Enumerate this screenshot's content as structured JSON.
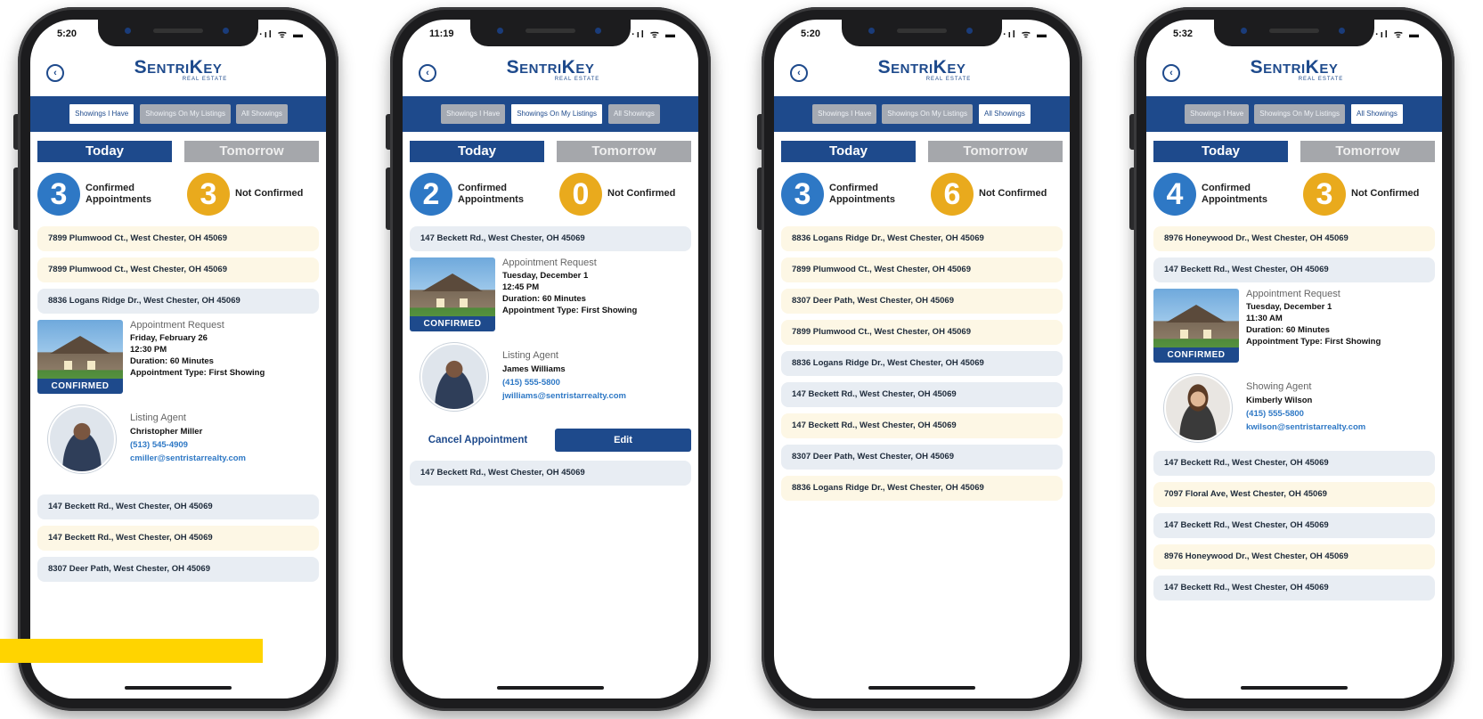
{
  "app": {
    "brand": "SentriKey",
    "sub": "REAL ESTATE"
  },
  "tabs": [
    "Showings I Have",
    "Showings On My Listings",
    "All Showings"
  ],
  "day_today": "Today",
  "day_tomorrow": "Tomorrow",
  "confirmed_label": "Confirmed Appointments",
  "not_confirmed_label": "Not Confirmed",
  "confirmed_badge": "CONFIRMED",
  "appt_heading": "Appointment Request",
  "colors": {
    "accent": "#1e4a8c",
    "count_blue": "#2e78c5",
    "count_gold": "#e9aa1d",
    "highlight": "#ffd400"
  },
  "phones": [
    {
      "time": "5:20",
      "status_icons": "·ıl ᯤ ▬",
      "confirmed": "3",
      "not_confirmed": "3",
      "pre_addresses": [
        "7899 Plumwood Ct., West Chester, OH 45069",
        "7899 Plumwood Ct., West Chester, OH 45069",
        "8836 Logans Ridge Dr., West Chester, OH 45069"
      ],
      "appointment": {
        "date": "Friday, February 26",
        "time": "12:30 PM",
        "duration": "Duration: 60 Minutes",
        "type": "Appointment Type: First Showing"
      },
      "agent": {
        "role": "Listing Agent",
        "name": "Christopher Miller",
        "phone": "(513) 545-4909",
        "email": "cmiller@sentristarrealty.com"
      },
      "post_addresses": [
        "147 Beckett Rd., West Chester, OH 45069",
        "147 Beckett Rd., West Chester, OH 45069",
        "8307 Deer Path, West Chester, OH 45069"
      ]
    },
    {
      "time": "11:19",
      "status_icons": "·ıl ᯤ ▬",
      "confirmed": "2",
      "not_confirmed": "0",
      "pre_addresses": [
        "147 Beckett Rd., West Chester, OH 45069"
      ],
      "appointment": {
        "date": "Tuesday, December 1",
        "time": "12:45 PM",
        "duration": "Duration: 60 Minutes",
        "type": "Appointment Type: First Showing"
      },
      "agent": {
        "role": "Listing Agent",
        "name": "James Williams",
        "phone": "(415) 555-5800",
        "email": "jwilliams@sentristarrealty.com"
      },
      "cancel_label": "Cancel Appointment",
      "edit_label": "Edit",
      "post_addresses": [
        "147 Beckett Rd., West Chester, OH 45069"
      ]
    },
    {
      "time": "5:20",
      "status_icons": "·ıl ᯤ ▬",
      "confirmed": "3",
      "not_confirmed": "6",
      "addresses": [
        "8836 Logans Ridge Dr., West Chester, OH 45069",
        "7899 Plumwood Ct., West Chester, OH 45069",
        "8307 Deer Path, West Chester, OH 45069",
        "7899 Plumwood Ct., West Chester, OH 45069",
        "8836 Logans Ridge Dr., West Chester, OH 45069",
        "147 Beckett Rd., West Chester, OH 45069",
        "147 Beckett Rd., West Chester, OH 45069",
        "8307 Deer Path, West Chester, OH 45069",
        "8836 Logans Ridge Dr., West Chester, OH 45069"
      ]
    },
    {
      "time": "5:32",
      "status_icons": "·ıl ᯤ ▬",
      "confirmed": "4",
      "not_confirmed": "3",
      "pre_addresses": [
        "8976 Honeywood Dr., West Chester, OH 45069",
        "147 Beckett Rd., West Chester, OH 45069"
      ],
      "appointment": {
        "date": "Tuesday, December 1",
        "time": "11:30 AM",
        "duration": "Duration: 60 Minutes",
        "type": "Appointment Type: First Showing"
      },
      "agent": {
        "role": "Showing Agent",
        "name": "Kimberly Wilson",
        "phone": "(415) 555-5800",
        "email": "kwilson@sentristarrealty.com"
      },
      "post_addresses": [
        "147 Beckett Rd., West Chester, OH 45069",
        "7097 Floral Ave, West Chester, OH 45069",
        "147 Beckett Rd., West Chester, OH 45069",
        "8976 Honeywood Dr., West Chester, OH 45069",
        "147 Beckett Rd., West Chester, OH 45069"
      ]
    }
  ]
}
